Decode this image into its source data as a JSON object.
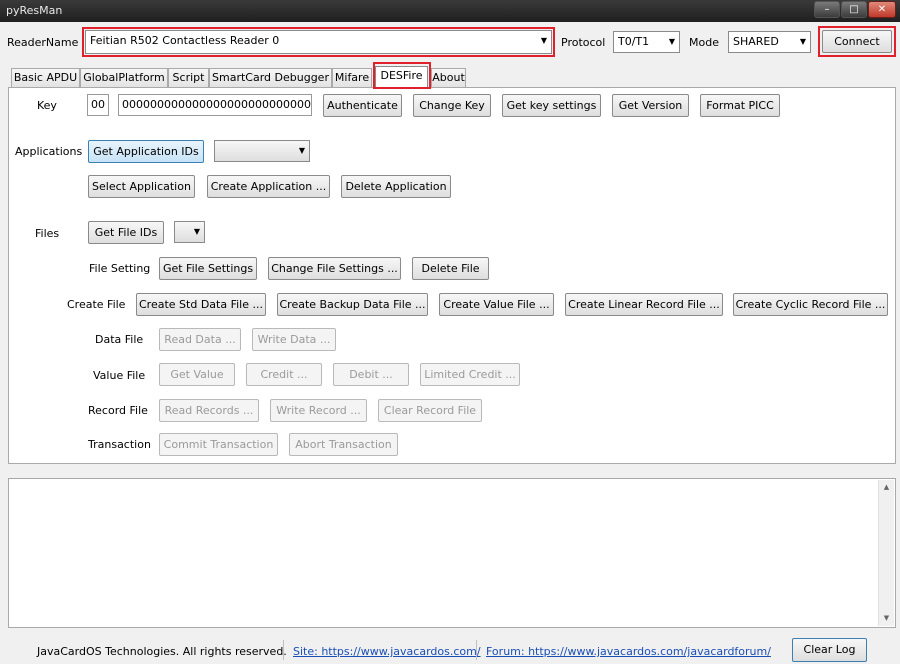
{
  "window": {
    "title": "pyResMan",
    "minimize": "–",
    "maximize": "□",
    "close": "✕"
  },
  "reader": {
    "label": "ReaderName",
    "value": "Feitian R502 Contactless Reader 0",
    "protocol_label": "Protocol",
    "protocol_value": "T0/T1",
    "mode_label": "Mode",
    "mode_value": "SHARED",
    "connect_label": "Connect"
  },
  "tabs": [
    "Basic APDU",
    "GlobalPlatform",
    "Script",
    "SmartCard Debugger",
    "Mifare",
    "DESFire",
    "About"
  ],
  "selected_tab": "DESFire",
  "key": {
    "label": "Key",
    "key_no": "00",
    "key_value": "00000000000000000000000000000000",
    "buttons": [
      "Authenticate",
      "Change Key",
      "Get key settings",
      "Get Version",
      "Format PICC"
    ]
  },
  "applications": {
    "label": "Applications",
    "get_ids": "Get Application IDs",
    "combo_value": "",
    "select": "Select Application",
    "create": "Create Application ...",
    "delete": "Delete Application"
  },
  "files": {
    "label": "Files",
    "get_ids": "Get File IDs",
    "combo_value": "",
    "file_setting_label": "File Setting",
    "get_settings": "Get File Settings",
    "change_settings": "Change File Settings ...",
    "delete_file": "Delete File",
    "create_file_label": "Create File",
    "create_std": "Create Std Data File ...",
    "create_backup": "Create Backup Data File ...",
    "create_value": "Create Value File ...",
    "create_linear": "Create Linear Record File ...",
    "create_cyclic": "Create Cyclic Record File ...",
    "data_file_label": "Data File",
    "read_data": "Read Data ...",
    "write_data": "Write Data ...",
    "value_file_label": "Value File",
    "get_value": "Get Value",
    "credit": "Credit ...",
    "debit": "Debit ...",
    "limited_credit": "Limited Credit ...",
    "record_file_label": "Record File",
    "read_records": "Read Records ...",
    "write_record": "Write Record ...",
    "clear_record": "Clear Record File",
    "transaction_label": "Transaction",
    "commit": "Commit Transaction",
    "abort": "Abort Transaction"
  },
  "footer": {
    "copyright": "JavaCardOS Technologies. All rights reserved.",
    "site": "Site: https://www.javacardos.com/",
    "forum": "Forum: https://www.javacardos.com/javacardforum/",
    "clear_log": "Clear Log"
  },
  "colors": {
    "highlight": "#e0202a",
    "link": "#1a4fb5",
    "titlebar": "#2a2a2a"
  }
}
